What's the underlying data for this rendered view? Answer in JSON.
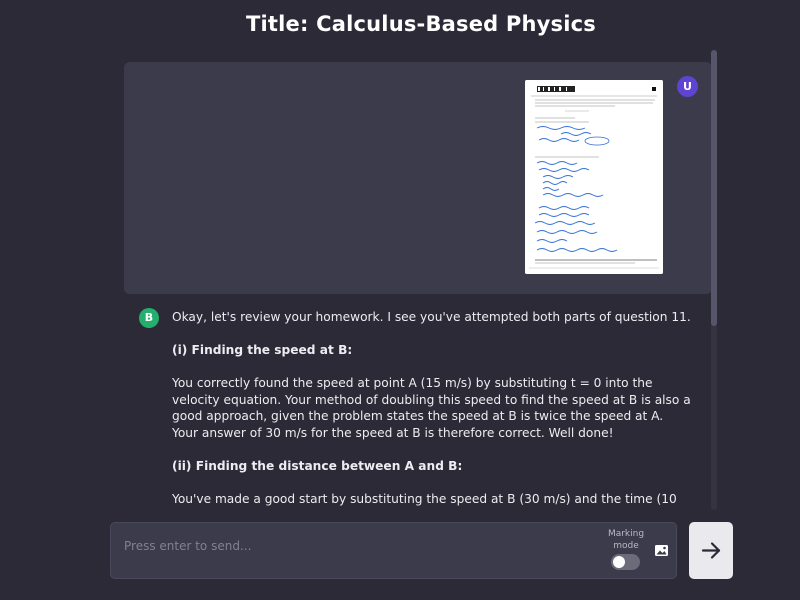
{
  "header": {
    "title": "Title: Calculus-Based Physics"
  },
  "user_message": {
    "avatar_letter": "U",
    "avatar_color": "#5f43d3",
    "attachment_icon": "homework-photo"
  },
  "bot_message": {
    "avatar_letter": "B",
    "avatar_color": "#24b06c",
    "paragraphs": [
      "Okay, let's review your homework. I see you've attempted both parts of question 11.",
      "(i) Finding the speed at B:",
      "You correctly found the speed at point A (15 m/s) by substituting t = 0 into the velocity equation. Your method of doubling this speed to find the speed at B is also a good approach, given the problem states the speed at B is twice the speed at A. Your answer of 30 m/s for the speed at B is therefore correct. Well done!",
      "(ii) Finding the distance between A and B:",
      "You've made a good start by substituting the speed at B (30 m/s) and the time (10"
    ]
  },
  "composer": {
    "placeholder": "Press enter to send...",
    "marking_mode_label": "Marking mode",
    "marking_mode_on": false,
    "image_icon": "image-icon",
    "send_icon": "arrow-right-icon"
  },
  "colors": {
    "background": "#2b2a36",
    "panel": "#3c3b4b",
    "send_button": "#e9e9ee"
  }
}
